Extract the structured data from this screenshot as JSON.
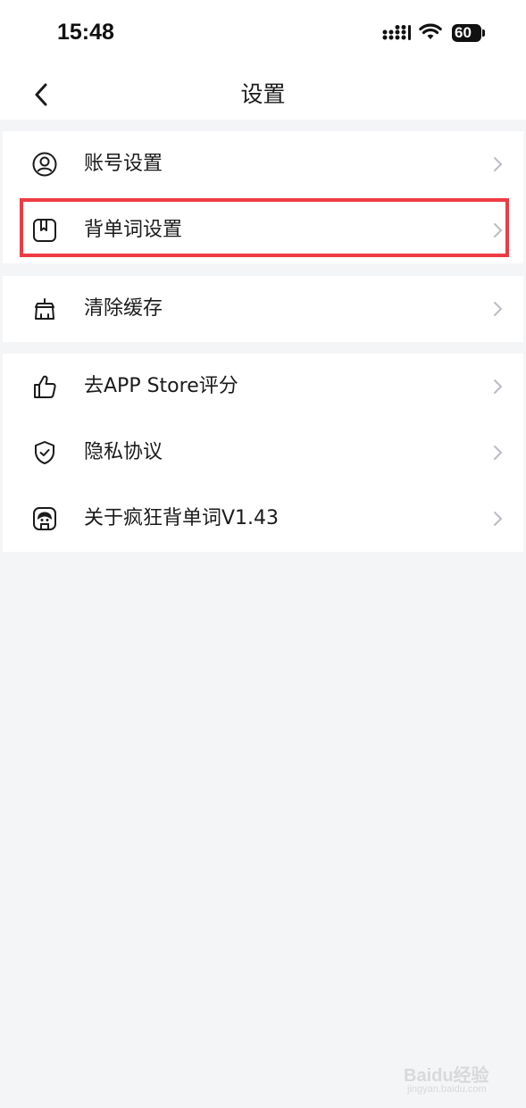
{
  "status_bar": {
    "time": "15:48",
    "battery_level": "60",
    "icons": [
      "signal-icon",
      "wifi-icon",
      "battery-icon"
    ]
  },
  "nav": {
    "title": "设置",
    "back_icon": "chevron-left-icon"
  },
  "groups": [
    {
      "items": [
        {
          "label": "账号设置",
          "icon": "user-circle-icon"
        },
        {
          "label": "背单词设置",
          "icon": "book-icon",
          "highlighted": true
        }
      ]
    },
    {
      "items": [
        {
          "label": "清除缓存",
          "icon": "broom-icon"
        }
      ]
    },
    {
      "items": [
        {
          "label": "去APP Store评分",
          "icon": "thumbs-up-icon"
        },
        {
          "label": "隐私协议",
          "icon": "shield-check-icon"
        },
        {
          "label": "关于疯狂背单词V1.43",
          "icon": "app-logo-icon"
        }
      ]
    }
  ],
  "colors": {
    "highlight": "#ee3b43",
    "background": "#f4f5f7",
    "chevron": "#b9bcc1"
  },
  "watermark": {
    "text": "Baidu经验",
    "sub": "jingyan.baidu.com"
  }
}
